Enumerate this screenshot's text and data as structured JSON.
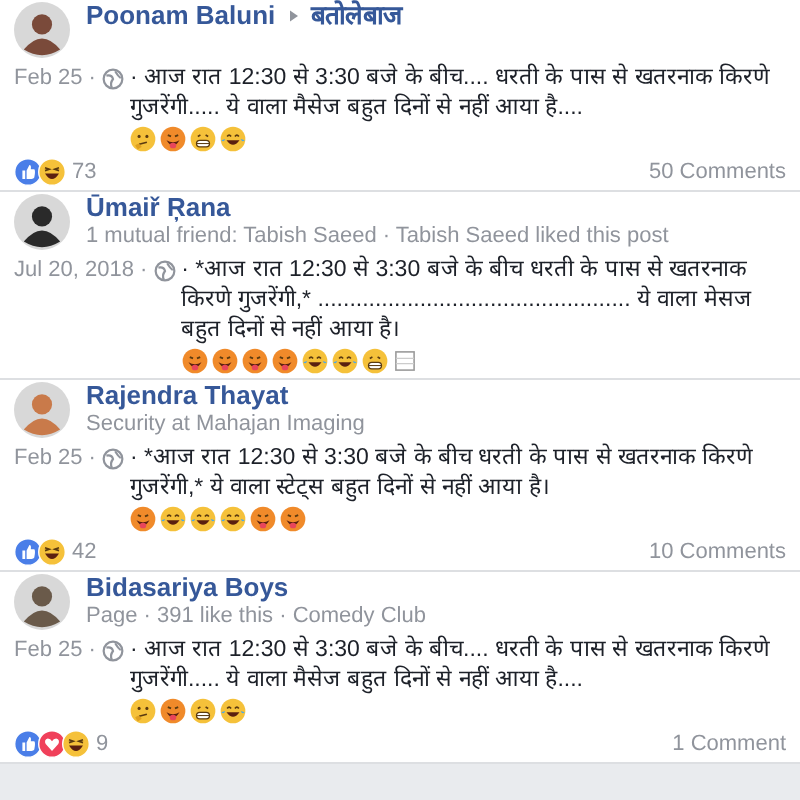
{
  "posts": [
    {
      "author": "Poonam Baluni",
      "group": "बतोलेबाज",
      "date": "Feb 25 ·",
      "text": "· आज रात 12:30 से 3:30 बजे के बीच.... धरती के पास से खतरनाक किरणे गुजरेंगी..... ये वाला मैसेज बहुत दिनों से नहीं आया है....",
      "emojis": [
        {
          "kind": "thinking"
        },
        {
          "kind": "tongue"
        },
        {
          "kind": "grin"
        },
        {
          "kind": "joy"
        }
      ],
      "reactions": [
        {
          "kind": "like"
        },
        {
          "kind": "haha"
        }
      ],
      "reaction_count": "73",
      "comments": "50 Comments"
    },
    {
      "author": "Ūmaiř Ŗana",
      "subtitle": "1 mutual friend: Tabish Saeed · Tabish Saeed liked this post",
      "date": "Jul 20, 2018 ·",
      "text": "· *आज रात 12:30 से 3:30 बजे के बीच धरती के पास से खतरनाक किरणे गुजरेंगी,* ................................................. ये वाला मेसज बहुत दिनों से नहीं आया है।",
      "emojis": [
        {
          "kind": "tongue"
        },
        {
          "kind": "tongue"
        },
        {
          "kind": "tongue"
        },
        {
          "kind": "tongue"
        },
        {
          "kind": "joy"
        },
        {
          "kind": "joy"
        },
        {
          "kind": "grin"
        },
        {
          "kind": "box"
        }
      ]
    },
    {
      "author": "Rajendra Thayat",
      "subtitle": "Security at Mahajan Imaging",
      "date": "Feb 25 ·",
      "text": "· *आज रात 12:30 से 3:30 बजे के बीच धरती के पास से खतरनाक किरणे गुजरेंगी,* ये वाला स्टेट्स बहुत दिनों से नहीं आया है।",
      "emojis": [
        {
          "kind": "tongue"
        },
        {
          "kind": "joy"
        },
        {
          "kind": "joy"
        },
        {
          "kind": "joy"
        },
        {
          "kind": "tongue"
        },
        {
          "kind": "tongue"
        }
      ],
      "reactions": [
        {
          "kind": "like"
        },
        {
          "kind": "haha"
        }
      ],
      "reaction_count": "42",
      "comments": "10 Comments"
    },
    {
      "author": "Bidasariya Boys",
      "subtitle": "Page · 391 like this · Comedy Club",
      "date": "Feb 25 ·",
      "text": "· आज रात 12:30 से 3:30 बजे के बीच.... धरती के पास से खतरनाक किरणे गुजरेंगी..... ये वाला मैसेज बहुत दिनों से नहीं आया है....",
      "emojis": [
        {
          "kind": "thinking"
        },
        {
          "kind": "tongue"
        },
        {
          "kind": "grin"
        },
        {
          "kind": "joy"
        }
      ],
      "reactions": [
        {
          "kind": "like"
        },
        {
          "kind": "love"
        },
        {
          "kind": "haha"
        }
      ],
      "reaction_count": "9",
      "comments": "1 Comment"
    }
  ]
}
